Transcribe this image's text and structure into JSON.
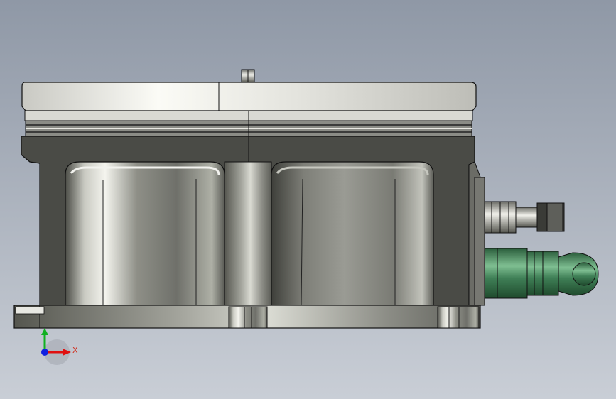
{
  "viewport": {
    "background_top": "#8f98a6",
    "background_bottom": "#c7ccd4"
  },
  "triad": {
    "x_label": "X",
    "x_color": "#e01010",
    "y_color": "#10b020",
    "z_color": "#1020e0",
    "label_color": "#d03020"
  },
  "part": {
    "body_color": "#8a8c84",
    "cap_color": "#f2f2ee",
    "fitting_color": "#3f7f56",
    "edge_color": "#111111"
  }
}
